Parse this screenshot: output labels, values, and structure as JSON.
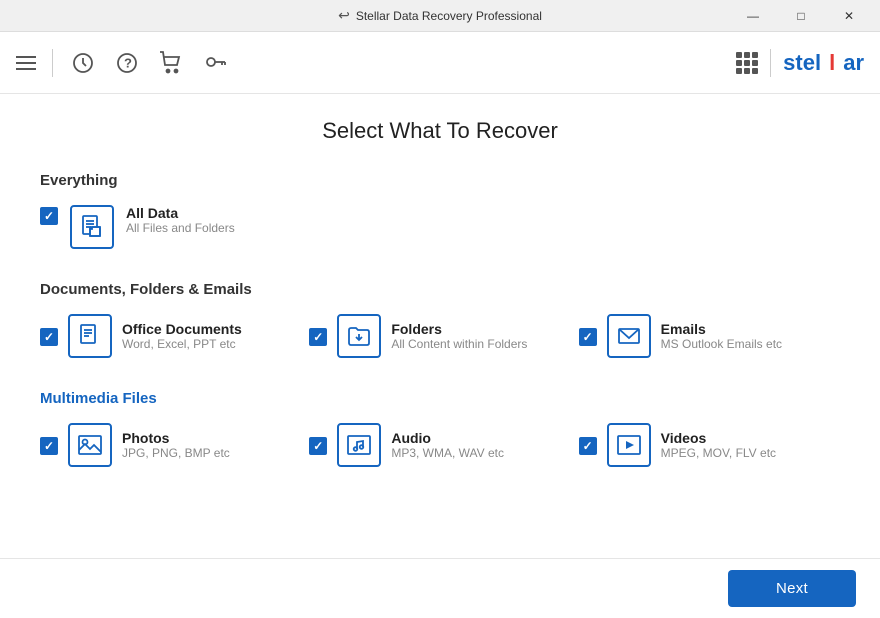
{
  "titleBar": {
    "title": "Stellar Data Recovery Professional",
    "backIcon": "↩",
    "minimize": "—",
    "maximize": "□",
    "close": "✕"
  },
  "toolbar": {
    "icons": [
      "hamburger",
      "timer",
      "help",
      "cart",
      "key"
    ]
  },
  "logo": {
    "text_before": "stel",
    "text_highlight": "l",
    "text_after": "ar"
  },
  "page": {
    "title": "Select What To Recover"
  },
  "sections": {
    "everything": {
      "title": "Everything",
      "items": [
        {
          "label": "All Data",
          "desc": "All Files and Folders",
          "checked": true,
          "icon": "alldata"
        }
      ]
    },
    "documents": {
      "title": "Documents, Folders & Emails",
      "items": [
        {
          "label": "Office Documents",
          "desc": "Word, Excel, PPT etc",
          "checked": true,
          "icon": "document"
        },
        {
          "label": "Folders",
          "desc": "All Content within Folders",
          "checked": true,
          "icon": "folder"
        },
        {
          "label": "Emails",
          "desc": "MS Outlook Emails etc",
          "checked": true,
          "icon": "email"
        }
      ]
    },
    "multimedia": {
      "title": "Multimedia Files",
      "items": [
        {
          "label": "Photos",
          "desc": "JPG, PNG, BMP etc",
          "checked": true,
          "icon": "photo"
        },
        {
          "label": "Audio",
          "desc": "MP3, WMA, WAV etc",
          "checked": true,
          "icon": "audio"
        },
        {
          "label": "Videos",
          "desc": "MPEG, MOV, FLV etc",
          "checked": true,
          "icon": "video"
        }
      ]
    }
  },
  "footer": {
    "nextLabel": "Next"
  }
}
